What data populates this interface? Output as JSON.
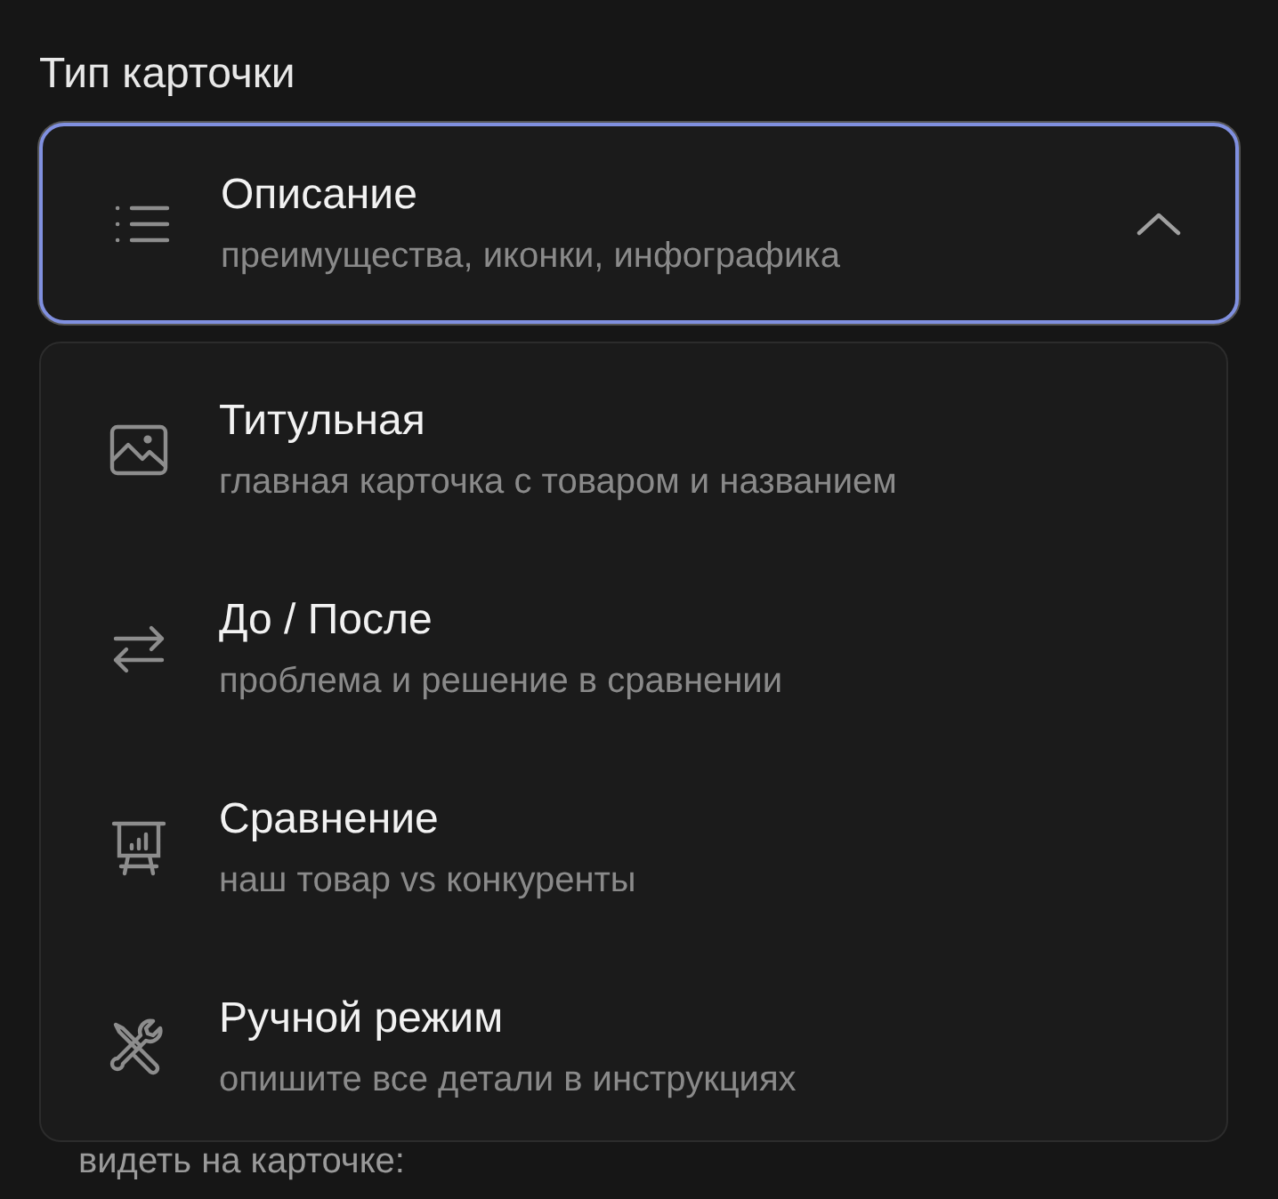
{
  "label": "Тип карточки",
  "select": {
    "title": "Описание",
    "subtitle": "преимущества, иконки, инфографика",
    "expanded": true
  },
  "options": [
    {
      "title": "Титульная",
      "subtitle": "главная карточка с товаром и названием",
      "selected": false
    },
    {
      "title": "До / После",
      "subtitle": "проблема и решение в сравнении",
      "selected": false
    },
    {
      "title": "Сравнение",
      "subtitle": "наш товар vs конкуренты",
      "selected": false
    },
    {
      "title": "Ручной режим",
      "subtitle": "опишите все детали в инструкциях",
      "selected": false
    }
  ],
  "hint": "видеть на карточке:"
}
